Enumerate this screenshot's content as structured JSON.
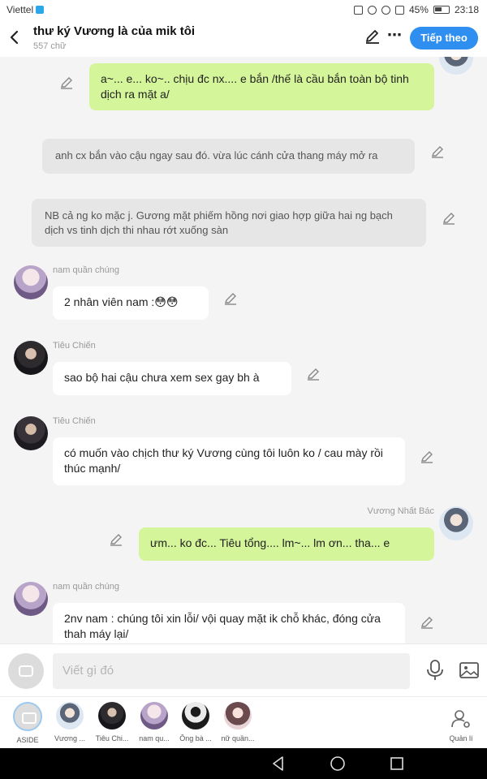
{
  "status_bar": {
    "carrier": "Viettel",
    "battery": "45%",
    "time": "23:18"
  },
  "header": {
    "title": "thư ký Vương là của mik tôi",
    "subtitle": "557 chữ",
    "next_button": "Tiếp theo"
  },
  "messages": [
    {
      "id": "m1",
      "type": "outgoing",
      "text": "a~... e... ko~.. chịu đc nx.... e bắn /thế là cầu bắn toàn bộ tinh dịch ra mặt a/"
    },
    {
      "id": "m2",
      "type": "narration",
      "text": "anh cx bắn vào cậu ngay sau đó. vừa lúc cánh cửa thang máy mở ra"
    },
    {
      "id": "m3",
      "type": "narration",
      "text": "NB cả ng ko mặc j. Gương mặt phiếm hồng nơi giao hợp giữa hai ng bạch dịch vs tinh dịch thi nhau rớt xuống sàn"
    },
    {
      "id": "m4",
      "type": "incoming",
      "sender": "nam quần chúng",
      "text": "2 nhân viên nam :😳😳"
    },
    {
      "id": "m5",
      "type": "incoming",
      "sender": "Tiêu Chiến",
      "text": "sao bộ hai cậu chưa xem sex gay bh à"
    },
    {
      "id": "m6",
      "type": "incoming",
      "sender": "Tiêu Chiến",
      "text": "có muốn vào chịch thư ký Vương cùng tôi luôn ko /  cau mày rồi thúc mạnh/"
    },
    {
      "id": "m7",
      "type": "outgoing",
      "sender": "Vương Nhất Bác",
      "text": "ưm... ko đc... Tiêu tổng.... lm~... lm ơn... tha... e"
    },
    {
      "id": "m8",
      "type": "incoming",
      "sender": "nam quần chúng",
      "text": "2nv nam : chúng tôi xin lỗi/ vội quay  mặt ik chỗ khác, đóng cửa thah máy lại/"
    }
  ],
  "input": {
    "placeholder": "Viết gì đó"
  },
  "characters": [
    {
      "label": "ASIDE",
      "avatar": "aside-icon"
    },
    {
      "label": "Vương ...",
      "avatar": "light"
    },
    {
      "label": "Tiêu Chi...",
      "avatar": "photo"
    },
    {
      "label": "nam qu...",
      "avatar": "anime"
    },
    {
      "label": "Ông bà ...",
      "avatar": "shadow"
    },
    {
      "label": "nữ quần...",
      "avatar": "girl"
    }
  ],
  "manage_label": "Quản lí",
  "colors": {
    "accent": "#2e8ff0",
    "outgoing_bubble": "#d5f59a",
    "incoming_bubble": "#ffffff",
    "narration_bubble": "#e6e6e6"
  }
}
